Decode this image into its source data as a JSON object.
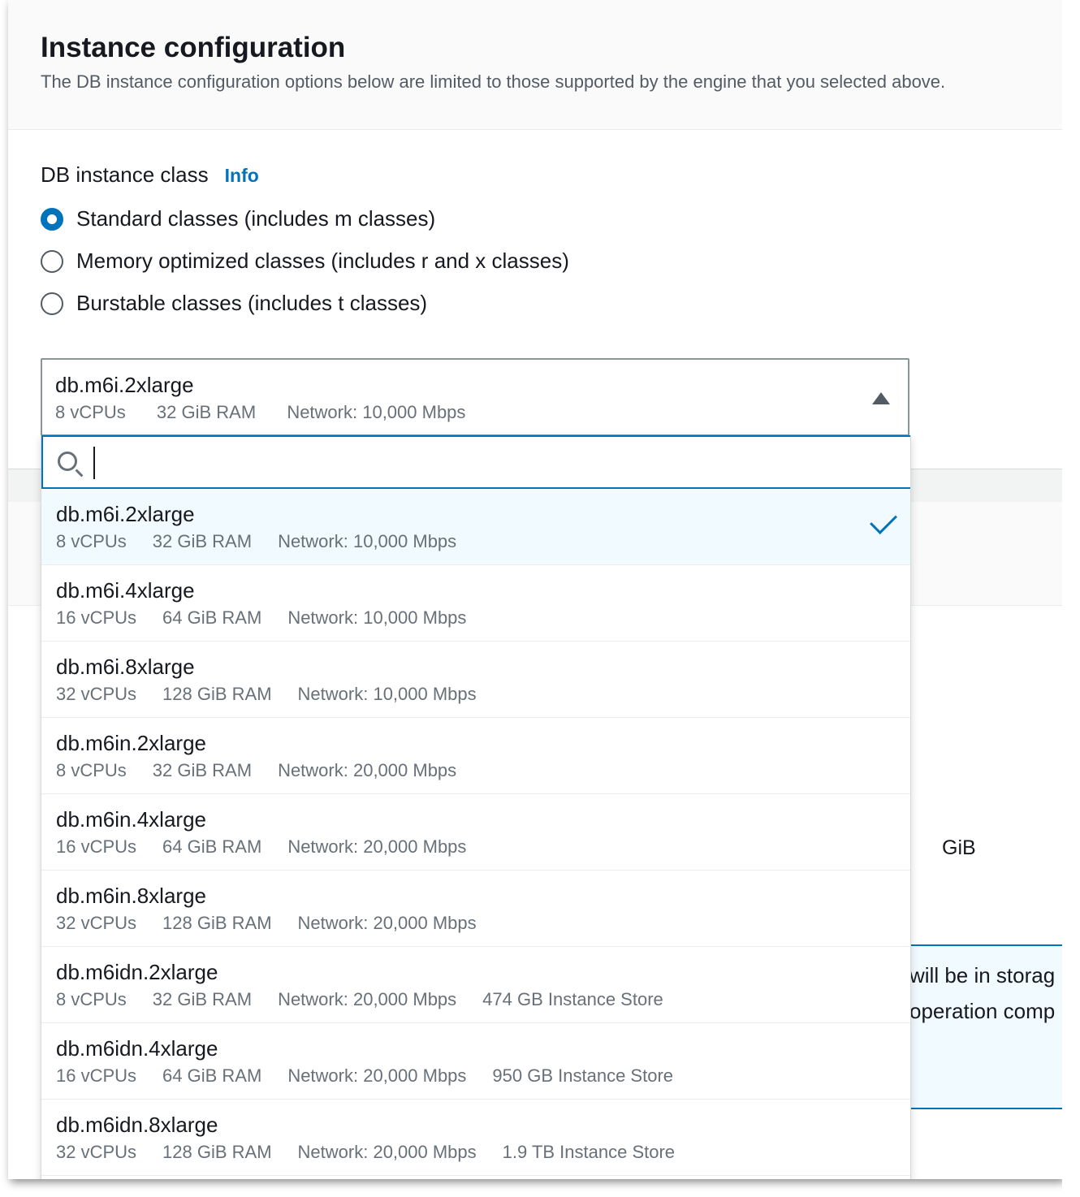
{
  "section": {
    "title": "Instance configuration",
    "description": "The DB instance configuration options below are limited to those supported by the engine that you selected above."
  },
  "instance_class": {
    "label": "DB instance class",
    "info_link": "Info",
    "radios": [
      {
        "label": "Standard classes (includes m classes)",
        "checked": true
      },
      {
        "label": "Memory optimized classes (includes r and x classes)",
        "checked": false
      },
      {
        "label": "Burstable classes (includes t classes)",
        "checked": false
      }
    ]
  },
  "select": {
    "name": "db.m6i.2xlarge",
    "vcpus": "8 vCPUs",
    "ram": "32 GiB RAM",
    "network": "Network: 10,000 Mbps"
  },
  "search": {
    "placeholder": "",
    "value": ""
  },
  "options": [
    {
      "name": "db.m6i.2xlarge",
      "vcpus": "8 vCPUs",
      "ram": "32 GiB RAM",
      "network": "Network: 10,000 Mbps",
      "store": "",
      "selected": true
    },
    {
      "name": "db.m6i.4xlarge",
      "vcpus": "16 vCPUs",
      "ram": "64 GiB RAM",
      "network": "Network: 10,000 Mbps",
      "store": ""
    },
    {
      "name": "db.m6i.8xlarge",
      "vcpus": "32 vCPUs",
      "ram": "128 GiB RAM",
      "network": "Network: 10,000 Mbps",
      "store": ""
    },
    {
      "name": "db.m6in.2xlarge",
      "vcpus": "8 vCPUs",
      "ram": "32 GiB RAM",
      "network": "Network: 20,000 Mbps",
      "store": ""
    },
    {
      "name": "db.m6in.4xlarge",
      "vcpus": "16 vCPUs",
      "ram": "64 GiB RAM",
      "network": "Network: 20,000 Mbps",
      "store": ""
    },
    {
      "name": "db.m6in.8xlarge",
      "vcpus": "32 vCPUs",
      "ram": "128 GiB RAM",
      "network": "Network: 20,000 Mbps",
      "store": ""
    },
    {
      "name": "db.m6idn.2xlarge",
      "vcpus": "8 vCPUs",
      "ram": "32 GiB RAM",
      "network": "Network: 20,000 Mbps",
      "store": "474 GB Instance Store"
    },
    {
      "name": "db.m6idn.4xlarge",
      "vcpus": "16 vCPUs",
      "ram": "64 GiB RAM",
      "network": "Network: 20,000 Mbps",
      "store": "950 GB Instance Store"
    },
    {
      "name": "db.m6idn.8xlarge",
      "vcpus": "32 vCPUs",
      "ram": "128 GiB RAM",
      "network": "Network: 20,000 Mbps",
      "store": "1.9 TB Instance Store"
    }
  ],
  "background": {
    "unit_label": "GiB",
    "alert_line1": "will be in storag",
    "alert_line2": "operation comp"
  },
  "colors": {
    "accent": "#0073bb",
    "selected_bg": "#f1faff",
    "muted_text": "#687078"
  },
  "icons": {
    "search": "search-icon",
    "caret": "caret-up-icon",
    "check": "check-icon"
  }
}
